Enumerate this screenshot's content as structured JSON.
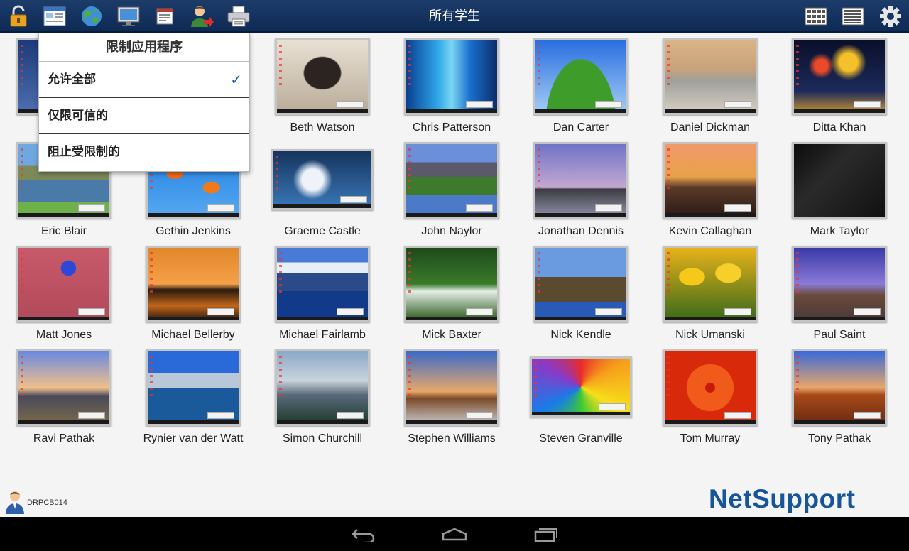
{
  "toolbar": {
    "title": "所有学生",
    "left_icons": [
      "lock-icon",
      "window-icon",
      "globe-icon",
      "monitor-icon",
      "message-icon",
      "user-transfer-icon",
      "printer-icon"
    ],
    "right_icons": [
      "large-thumbnails-icon",
      "list-view-icon",
      "settings-icon"
    ]
  },
  "menu": {
    "title": "限制应用程序",
    "items": [
      {
        "label": "允许全部",
        "checked": true
      },
      {
        "label": "仅限可信的",
        "checked": false
      },
      {
        "label": "阻止受限制的",
        "checked": false
      }
    ],
    "check_mark": "✓"
  },
  "students": [
    {
      "name": "",
      "wallpaper": "blue-moon"
    },
    {
      "name": "",
      "wallpaper": "hidden"
    },
    {
      "name": "Beth Watson",
      "wallpaper": "dog-sepia"
    },
    {
      "name": "Chris Patterson",
      "wallpaper": "aurora-blue"
    },
    {
      "name": "Dan Carter",
      "wallpaper": "green-hill"
    },
    {
      "name": "Daniel Dickman",
      "wallpaper": "misty-lake"
    },
    {
      "name": "Ditta Khan",
      "wallpaper": "fireworks"
    },
    {
      "name": "Eric Blair",
      "wallpaper": "mountain-lake"
    },
    {
      "name": "Gethin Jenkins",
      "wallpaper": "goldfish"
    },
    {
      "name": "Graeme Castle",
      "wallpaper": "dandelion"
    },
    {
      "name": "John Naylor",
      "wallpaper": "mountain-stream"
    },
    {
      "name": "Jonathan Dennis",
      "wallpaper": "stonehenge"
    },
    {
      "name": "Kevin Callaghan",
      "wallpaper": "rocky-sunset"
    },
    {
      "name": "Mark Taylor",
      "wallpaper": "black"
    },
    {
      "name": "Matt Jones",
      "wallpaper": "pink-wall"
    },
    {
      "name": "Michael Bellerby",
      "wallpaper": "orange-sunset"
    },
    {
      "name": "Michael Fairlamb",
      "wallpaper": "blue-mountains"
    },
    {
      "name": "Mick Baxter",
      "wallpaper": "forest-stream"
    },
    {
      "name": "Nick Kendle",
      "wallpaper": "sea-cliff"
    },
    {
      "name": "Nick Umanski",
      "wallpaper": "tulips"
    },
    {
      "name": "Paul Saint",
      "wallpaper": "lighthouse"
    },
    {
      "name": "Ravi Pathak",
      "wallpaper": "tower-bridge"
    },
    {
      "name": "Rynier van der Watt",
      "wallpaper": "sydney"
    },
    {
      "name": "Simon Churchill",
      "wallpaper": "canoe-lake"
    },
    {
      "name": "Stephen Williams",
      "wallpaper": "baobabs"
    },
    {
      "name": "Steven Granville",
      "wallpaper": "balloon"
    },
    {
      "name": "Tom Murray",
      "wallpaper": "red-flower"
    },
    {
      "name": "Tony Pathak",
      "wallpaper": "desert"
    }
  ],
  "footer": {
    "computer_name": "DRPCB014",
    "logo_text": "NetSupport"
  },
  "navbar": [
    "back-icon",
    "home-icon",
    "recent-apps-icon"
  ],
  "colors": {
    "toolbar": "#163563",
    "accent": "#1f5faa",
    "logo": "#16559a"
  }
}
